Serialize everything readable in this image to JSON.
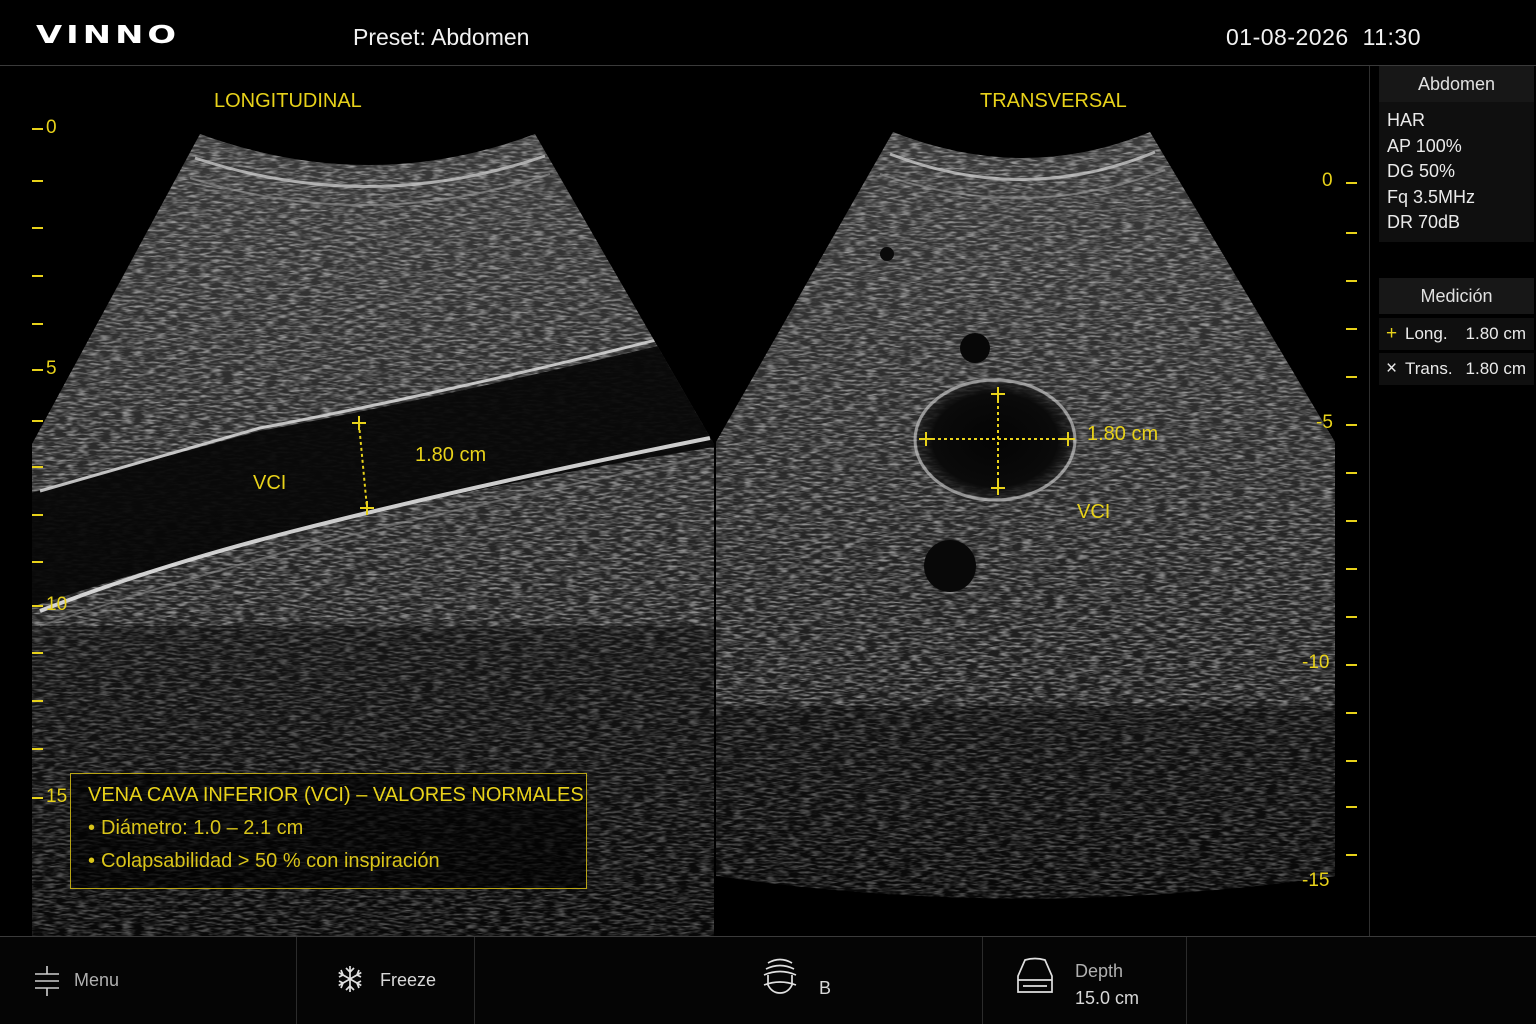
{
  "header": {
    "logo": "VINNO",
    "preset_label": "Preset:",
    "preset_value": "Abdomen",
    "date": "01-08-2026",
    "time": "11:30"
  },
  "views": {
    "left": {
      "title": "LONGITUDINAL",
      "vessel_label": "VCI",
      "measurement": "1.80 cm"
    },
    "right": {
      "title": "TRANSVERSAL",
      "vessel_label": "VCI",
      "measurement": "1.80 cm"
    }
  },
  "scales": {
    "left": [
      "0",
      "5",
      "10",
      "15"
    ],
    "right": [
      "0",
      "-5",
      "-10",
      "-15"
    ]
  },
  "info_box": {
    "title": "VENA CAVA INFERIOR (VCI) – VALORES NORMALES",
    "items": [
      "Diámetro: 1.0 – 2.1 cm",
      "Colapsabilidad > 50 % con inspiración"
    ]
  },
  "side_panel": {
    "preset_header": "Abdomen",
    "params": [
      "HAR",
      "AP 100%",
      "DG 50%",
      "Fq 3.5MHz",
      "DR 70dB"
    ],
    "measurement_header": "Medición",
    "measurements": [
      {
        "symbol": "+",
        "label": "Long.",
        "value": "1.80 cm"
      },
      {
        "symbol": "×",
        "label": "Trans.",
        "value": "1.80 cm"
      }
    ]
  },
  "bottom_bar": {
    "menu_label": "Menu",
    "freeze_label": "Freeze",
    "mode_label": "B",
    "depth_label": "Depth",
    "depth_value": "15.0 cm"
  },
  "colors": {
    "annotation": "#e8d21a",
    "background": "#000000"
  },
  "icons": {
    "menu": "menu-sliders-icon",
    "freeze": "snowflake-icon",
    "mode": "probe-b-mode-icon",
    "depth": "depth-sector-icon"
  }
}
